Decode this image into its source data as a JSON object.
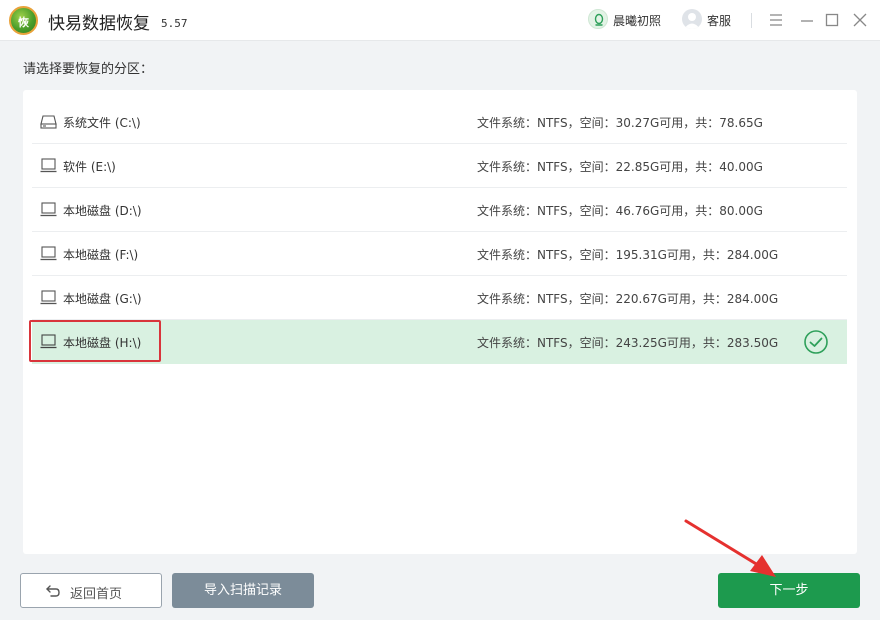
{
  "app": {
    "logo_text": "恢",
    "title": "快易数据恢复",
    "version": "5.57",
    "user_name": "晨曦初照",
    "service_label": "客服",
    "accent_color": "#1d9a4e",
    "selected_row_color": "#d9f1e1"
  },
  "prompt": "请选择要恢复的分区：",
  "partitions": [
    {
      "name": "系统文件 (C:\\)",
      "info": "文件系统：NTFS，空间：30.27G可用，共：78.65G",
      "icon": "hard-drive-icon"
    },
    {
      "name": "软件 (E:\\)",
      "info": "文件系统：NTFS，空间：22.85G可用，共：40.00G",
      "icon": "laptop-drive-icon"
    },
    {
      "name": "本地磁盘 (D:\\)",
      "info": "文件系统：NTFS，空间：46.76G可用，共：80.00G",
      "icon": "laptop-drive-icon"
    },
    {
      "name": "本地磁盘 (F:\\)",
      "info": "文件系统：NTFS，空间：195.31G可用，共：284.00G",
      "icon": "laptop-drive-icon"
    },
    {
      "name": "本地磁盘 (G:\\)",
      "info": "文件系统：NTFS，空间：220.67G可用，共：284.00G",
      "icon": "laptop-drive-icon"
    },
    {
      "name": "本地磁盘 (H:\\)",
      "info": "文件系统：NTFS，空间：243.25G可用，共：283.50G",
      "icon": "laptop-drive-icon",
      "selected": true
    }
  ],
  "buttons": {
    "home": "返回首页",
    "import": "导入扫描记录",
    "next": "下一步"
  }
}
